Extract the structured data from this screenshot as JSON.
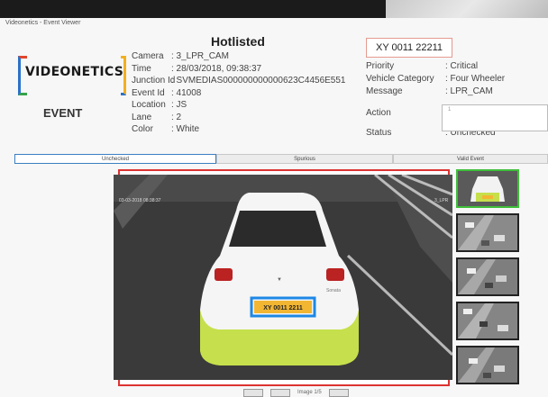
{
  "window": {
    "title": "Videonetics - Event Viewer"
  },
  "brand": {
    "logo_text": "VIDEONETICS",
    "event_label": "EVENT"
  },
  "header": {
    "title": "Hotlisted"
  },
  "plate": {
    "number": "XY 0011 22211"
  },
  "details": [
    {
      "key": "Camera",
      "value": ": 3_LPR_CAM"
    },
    {
      "key": "Time",
      "value": ": 28/03/2018, 09:38:37"
    },
    {
      "key": "Junction Id",
      "value": ": SVMEDIAS000000000000623C4456E551"
    },
    {
      "key": "Event Id",
      "value": ": 41008"
    },
    {
      "key": "Location",
      "value": ": JS"
    },
    {
      "key": "Lane",
      "value": ": 2"
    },
    {
      "key": "Color",
      "value": ": White"
    }
  ],
  "info": [
    {
      "key": "Priority",
      "value": ": Critical"
    },
    {
      "key": "Vehicle Category",
      "value": ": Four Wheeler"
    },
    {
      "key": "Message",
      "value": ": LPR_CAM"
    },
    {
      "key": "Action",
      "value": ""
    },
    {
      "key": "Status",
      "value": ": Unchecked"
    }
  ],
  "action_placeholder": "1",
  "tabs": [
    "Unchecked",
    "Spurious",
    "Valid Event"
  ],
  "image": {
    "timestamp": "03-03-2018 08:38:37",
    "camera_tag": "3_LPR",
    "plate_text": "XY 0011 2211",
    "car_tag": "Sonata"
  },
  "controls": {
    "page_label": "Image 1/5"
  },
  "colors": {
    "frame": "#dd3333",
    "thumb_active": "#3fbf3a",
    "plate_highlight": "#1e88e5",
    "tab_active": "#3a7fc2"
  }
}
